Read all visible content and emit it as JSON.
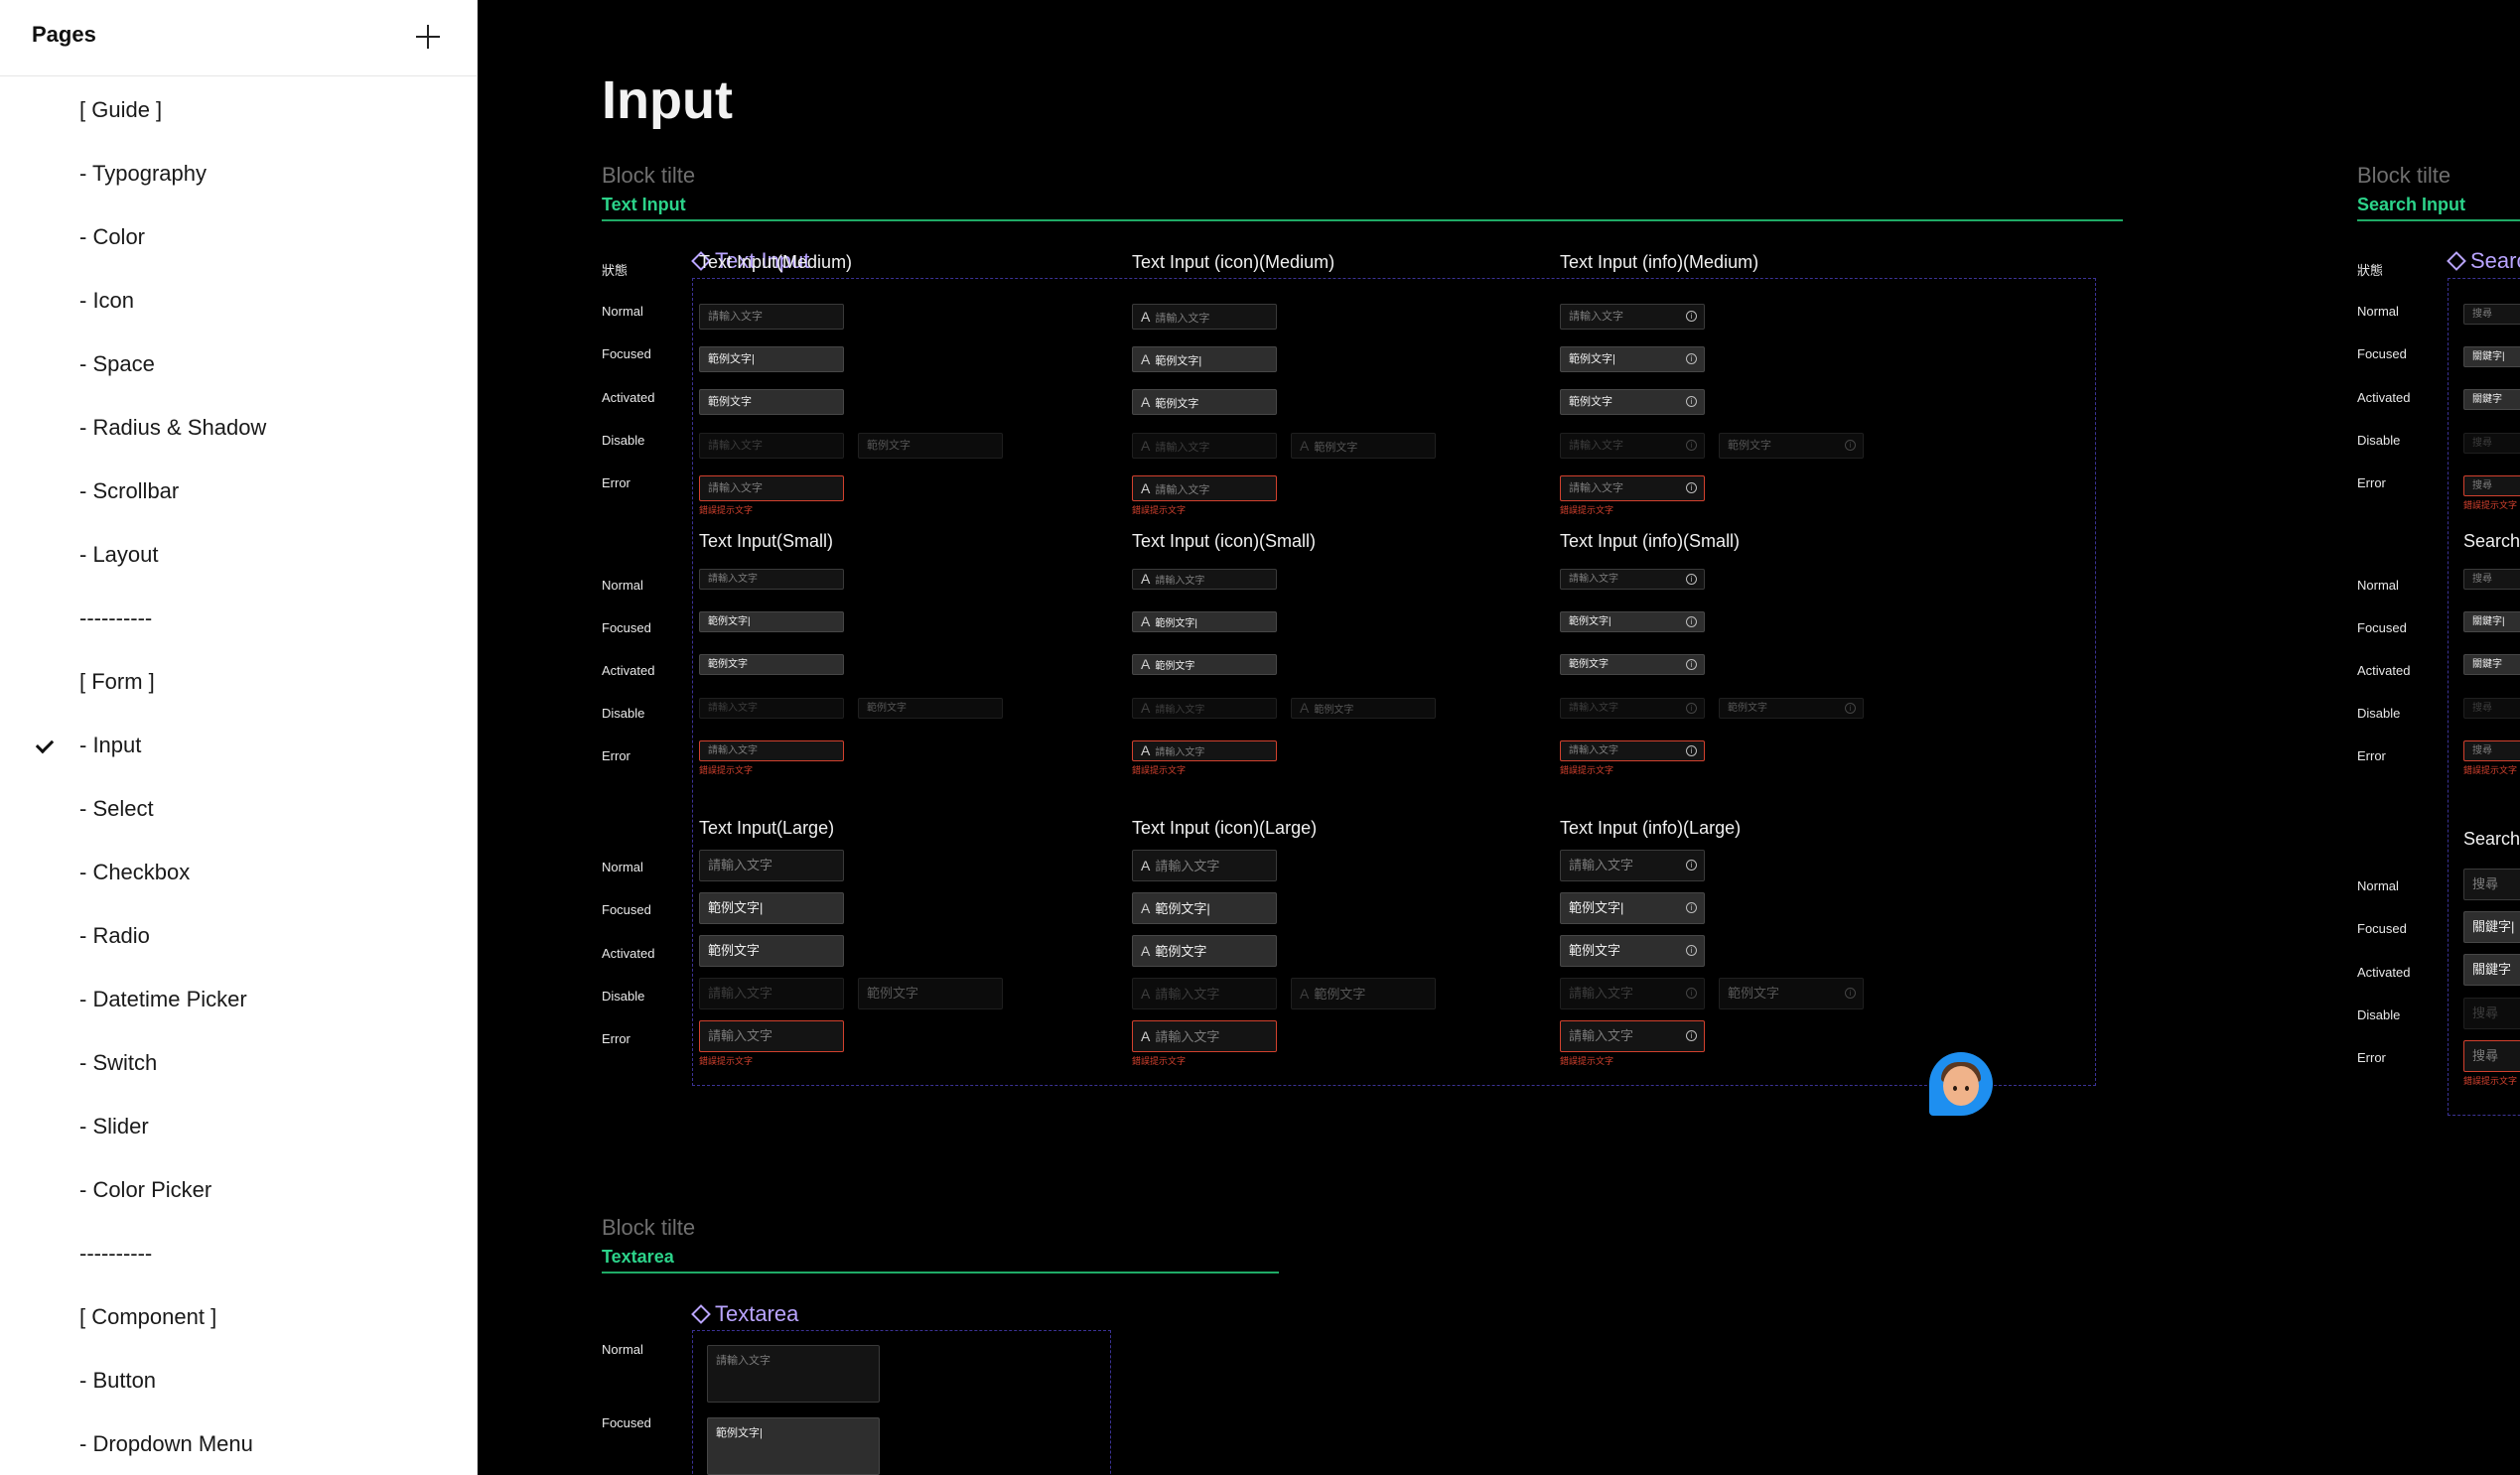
{
  "sidebar": {
    "title": "Pages",
    "pages": [
      {
        "label": "[ Guide ]",
        "selected": false
      },
      {
        "label": "- Typography",
        "selected": false
      },
      {
        "label": "- Color",
        "selected": false
      },
      {
        "label": "- Icon",
        "selected": false
      },
      {
        "label": "- Space",
        "selected": false
      },
      {
        "label": "- Radius & Shadow",
        "selected": false
      },
      {
        "label": "- Scrollbar",
        "selected": false
      },
      {
        "label": "- Layout",
        "selected": false
      },
      {
        "label": "----------",
        "selected": false
      },
      {
        "label": "[ Form ]",
        "selected": false
      },
      {
        "label": "- Input",
        "selected": true
      },
      {
        "label": "- Select",
        "selected": false
      },
      {
        "label": "- Checkbox",
        "selected": false
      },
      {
        "label": "- Radio",
        "selected": false
      },
      {
        "label": "- Datetime Picker",
        "selected": false
      },
      {
        "label": "- Switch",
        "selected": false
      },
      {
        "label": "- Slider",
        "selected": false
      },
      {
        "label": "- Color Picker",
        "selected": false
      },
      {
        "label": "----------",
        "selected": false
      },
      {
        "label": "[ Component ]",
        "selected": false
      },
      {
        "label": "- Button",
        "selected": false
      },
      {
        "label": "- Dropdown Menu",
        "selected": false
      }
    ]
  },
  "canvas": {
    "heading": "Input",
    "text_input_block": {
      "label": "Block tilte",
      "sub": "Text Input",
      "component": "Text Input",
      "state_header": "狀態",
      "states": [
        "Normal",
        "Focused",
        "Activated",
        "Disable",
        "Error"
      ],
      "sections": {
        "medium": [
          "Text Input(Medium)",
          "Text Input (icon)(Medium)",
          "Text Input (info)(Medium)"
        ],
        "small": [
          "Text Input(Small)",
          "Text Input (icon)(Small)",
          "Text Input (info)(Small)"
        ],
        "large": [
          "Text Input(Large)",
          "Text Input (icon)(Large)",
          "Text Input (info)(Large)"
        ]
      },
      "values": {
        "placeholder": "請輸入文字",
        "focused": "範例文字|",
        "activated": "範例文字",
        "error_message": "錯誤提示文字"
      },
      "icons": {
        "lead": "A",
        "info": "i"
      }
    },
    "search_input_block": {
      "label": "Block tilte",
      "sub": "Search Input",
      "component": "Search",
      "state_header": "狀態",
      "states": [
        "Normal",
        "Focused",
        "Activated",
        "Disable",
        "Error"
      ],
      "section_title": "Search",
      "values": {
        "placeholder": "搜尋",
        "focused": "關鍵字|",
        "activated": "關鍵字",
        "error_message": "錯誤提示文字"
      }
    },
    "textarea_block": {
      "label": "Block tilte",
      "sub": "Textarea",
      "component": "Textarea",
      "states": [
        "Normal",
        "Focused"
      ],
      "values": {
        "placeholder": "請輸入文字",
        "focused": "範例文字|"
      }
    }
  },
  "colors": {
    "accent_green": "#2cd38a",
    "component_purple": "#b9a4ff",
    "error_red": "#d2412e",
    "frame_dash": "#3b3295"
  }
}
